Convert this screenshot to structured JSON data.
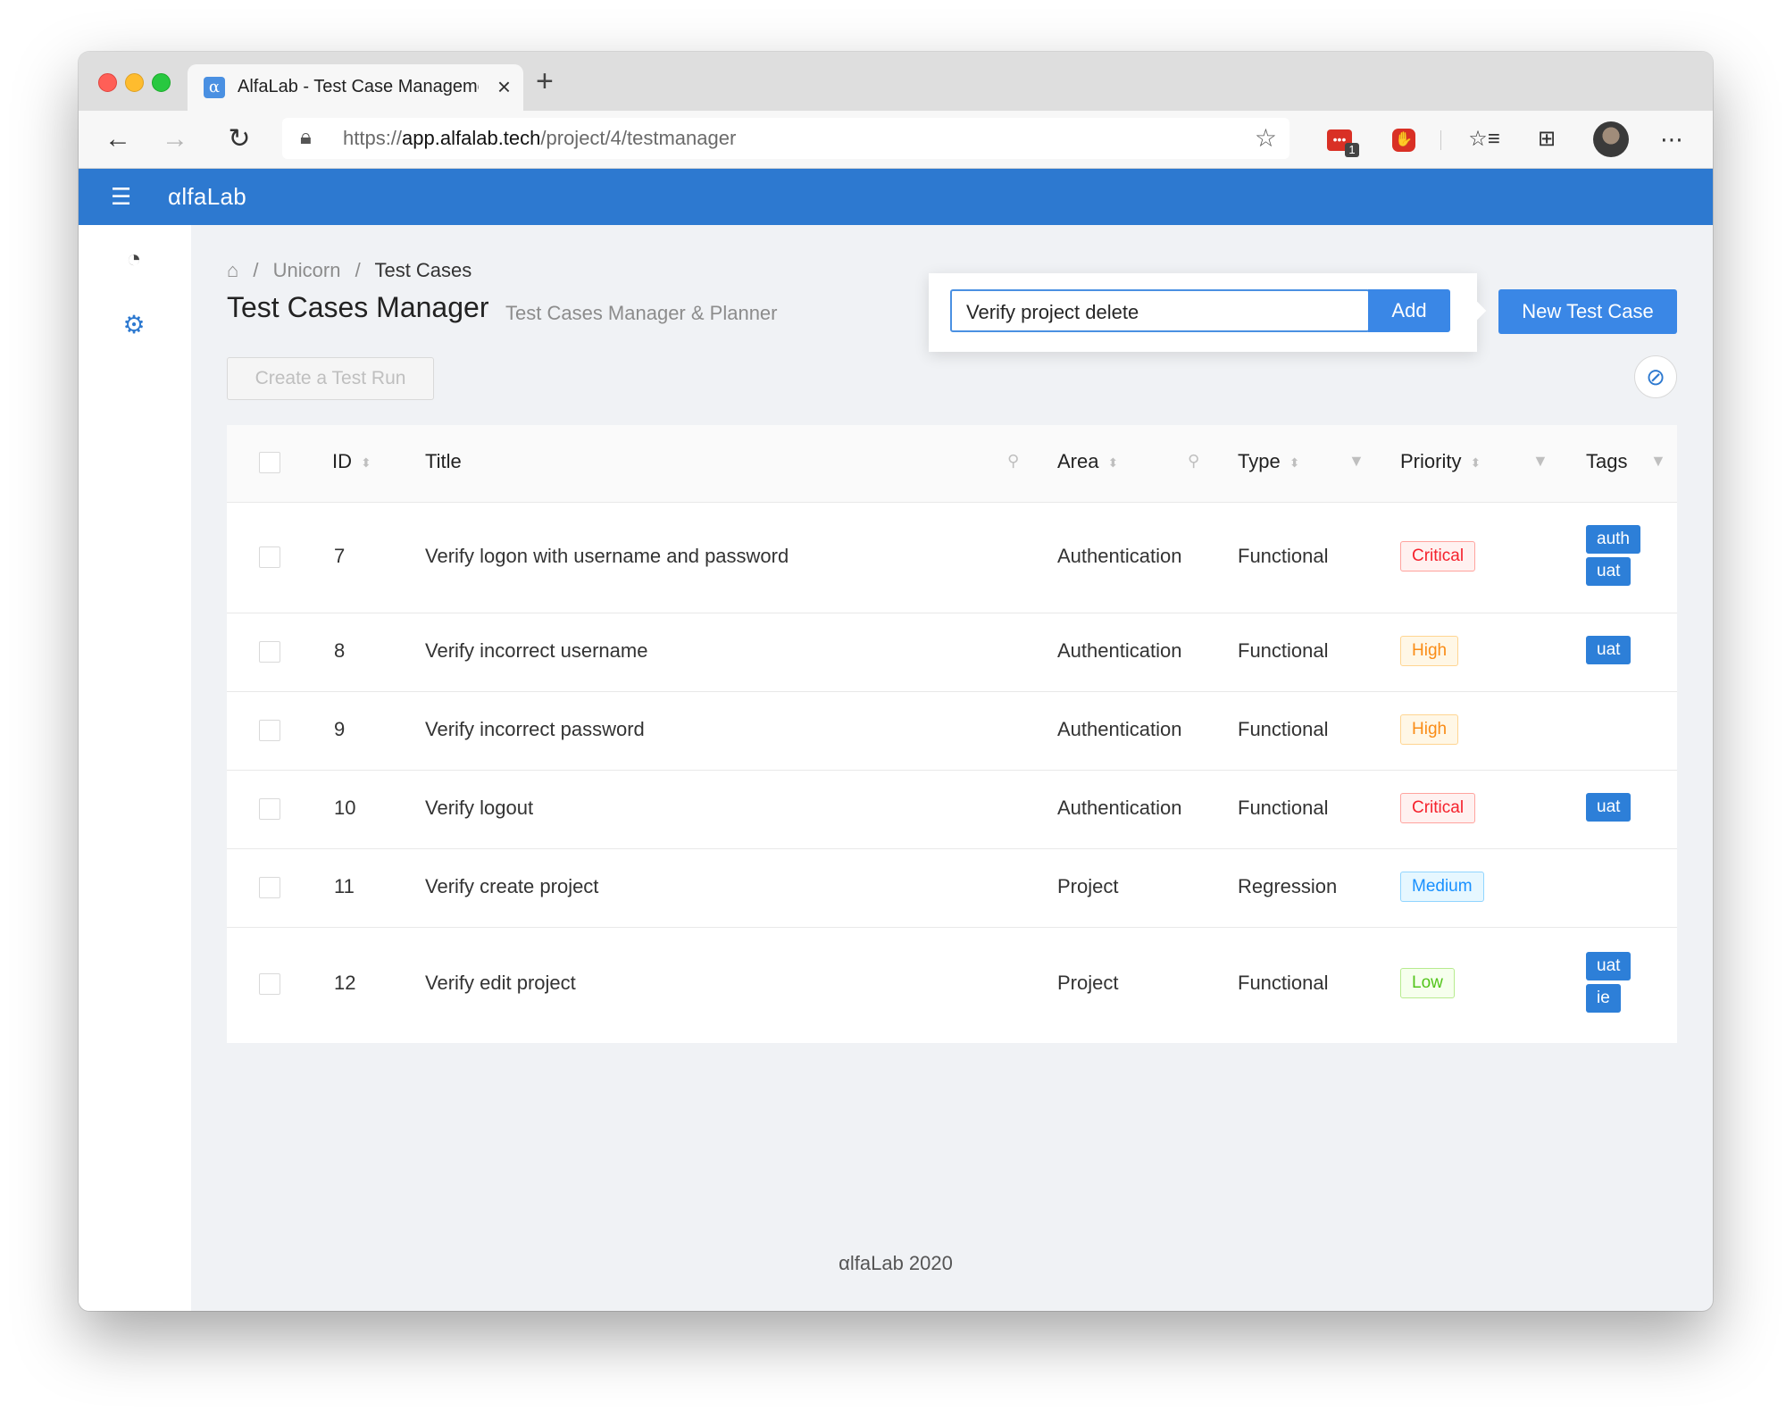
{
  "browser": {
    "tab_title": "AlfaLab - Test Case Manageme",
    "tab_favicon": "α",
    "url_prefix": "https://",
    "url_host": "app.alfalab.tech",
    "url_path": "/project/4/testmanager",
    "extension_badge": "1"
  },
  "app": {
    "brand": "αlfaLab",
    "accent_color": "#2d79d0"
  },
  "breadcrumb": {
    "items": [
      "Unicorn",
      "Test Cases"
    ]
  },
  "page": {
    "title": "Test Cases Manager",
    "subtitle": "Test Cases Manager & Planner",
    "create_run_label": "Create a Test Run",
    "new_case_label": "New Test Case"
  },
  "popover": {
    "input_value": "Verify project delete",
    "add_label": "Add"
  },
  "table": {
    "columns": [
      "ID",
      "Title",
      "Area",
      "Type",
      "Priority",
      "Tags"
    ],
    "rows": [
      {
        "id": "7",
        "title": "Verify logon with username and password",
        "area": "Authentication",
        "type": "Functional",
        "priority": "Critical",
        "tags": [
          "auth",
          "uat"
        ]
      },
      {
        "id": "8",
        "title": "Verify incorrect username",
        "area": "Authentication",
        "type": "Functional",
        "priority": "High",
        "tags": [
          "uat"
        ]
      },
      {
        "id": "9",
        "title": "Verify incorrect password",
        "area": "Authentication",
        "type": "Functional",
        "priority": "High",
        "tags": []
      },
      {
        "id": "10",
        "title": "Verify logout",
        "area": "Authentication",
        "type": "Functional",
        "priority": "Critical",
        "tags": [
          "uat"
        ]
      },
      {
        "id": "11",
        "title": "Verify create project",
        "area": "Project",
        "type": "Regression",
        "priority": "Medium",
        "tags": []
      },
      {
        "id": "12",
        "title": "Verify edit project",
        "area": "Project",
        "type": "Functional",
        "priority": "Low",
        "tags": [
          "uat",
          "ie"
        ]
      }
    ]
  },
  "footer": {
    "text": "αlfaLab 2020"
  }
}
